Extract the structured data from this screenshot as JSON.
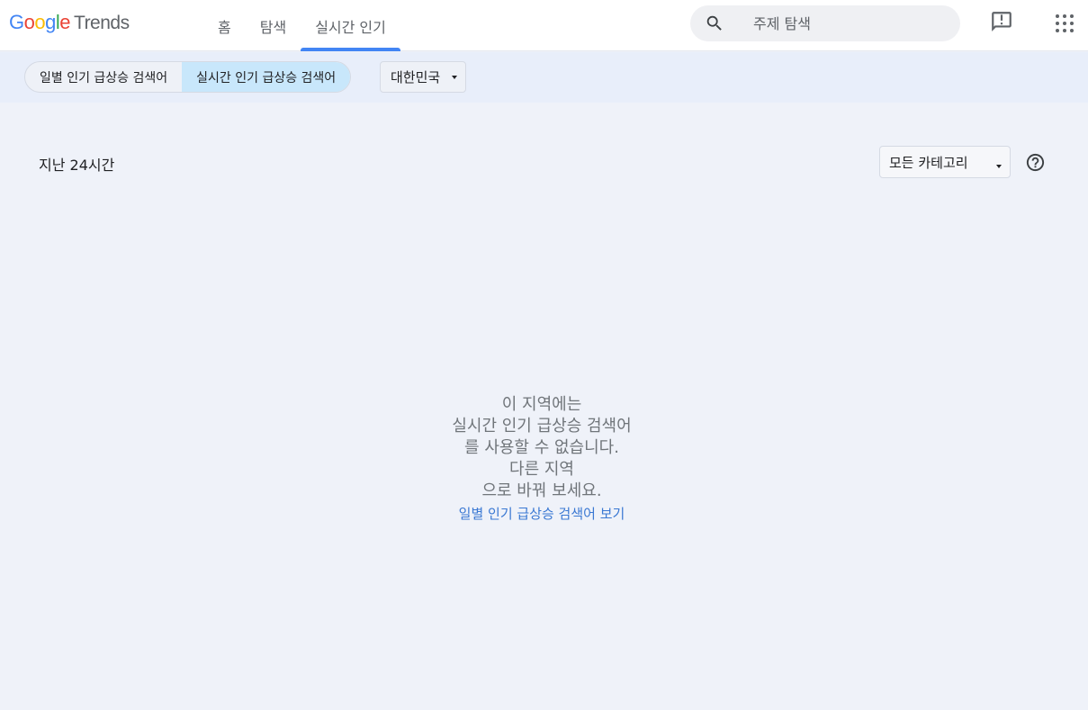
{
  "header": {
    "logo": {
      "google": [
        "G",
        "o",
        "o",
        "g",
        "l",
        "e"
      ],
      "product": "Trends"
    },
    "nav": [
      {
        "label": "홈",
        "active": false
      },
      {
        "label": "탐색",
        "active": false
      },
      {
        "label": "실시간 인기",
        "active": true
      }
    ],
    "search": {
      "placeholder": "주제 탐색",
      "icon": "search-icon"
    },
    "icons": {
      "feedback": "feedback-icon",
      "apps": "apps-grid-icon"
    }
  },
  "subbar": {
    "segments": [
      {
        "label": "일별 인기 급상승 검색어",
        "active": false
      },
      {
        "label": "실시간 인기 급상승 검색어",
        "active": true
      }
    ],
    "geo": {
      "selected": "대한민국"
    }
  },
  "main": {
    "period": "지난 24시간",
    "category": {
      "selected": "모든 카테고리"
    },
    "empty_message": [
      "이 지역에는",
      "실시간 인기 급상승 검색어",
      "를 사용할 수 없습니다.",
      "다른 지역",
      "으로 바꿔 보세요."
    ],
    "empty_link": "일별 인기 급상승 검색어 보기"
  },
  "colors": {
    "accent": "#4285f4",
    "segment_active": "#c8e7fb",
    "page_bg": "#eff2f9",
    "subbar_bg": "#e8eefa",
    "link": "#3a78d3"
  }
}
